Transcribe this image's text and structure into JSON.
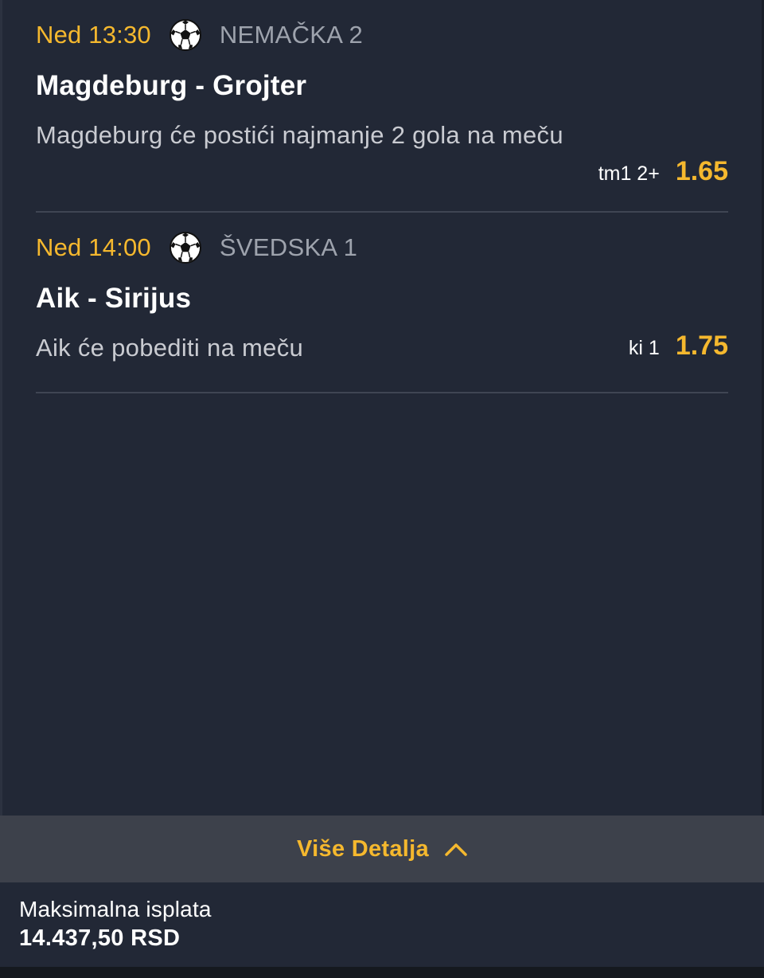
{
  "events": [
    {
      "time": "Ned 13:30",
      "sport_icon": "soccer-ball-icon",
      "league": "NEMAČKA 2",
      "match": "Magdeburg - Grojter",
      "description": "Magdeburg će postići najmanje 2 gola na meču",
      "odd_code": "tm1 2+",
      "odd_value": "1.65"
    },
    {
      "time": "Ned 14:00",
      "sport_icon": "soccer-ball-icon",
      "league": "ŠVEDSKA 1",
      "match": "Aik - Sirijus",
      "description": "Aik će pobediti na meču",
      "odd_code": "ki 1",
      "odd_value": "1.75"
    }
  ],
  "details_button": {
    "label": "Više Detalja",
    "icon": "chevron-up-icon"
  },
  "payout": {
    "label": "Maksimalna isplata",
    "value": "14.437,50 RSD"
  },
  "colors": {
    "background": "#222836",
    "accent": "#f5b82e",
    "details_bar": "#3d414b",
    "divider": "#3f4553",
    "league_text": "#9ea3ad"
  }
}
